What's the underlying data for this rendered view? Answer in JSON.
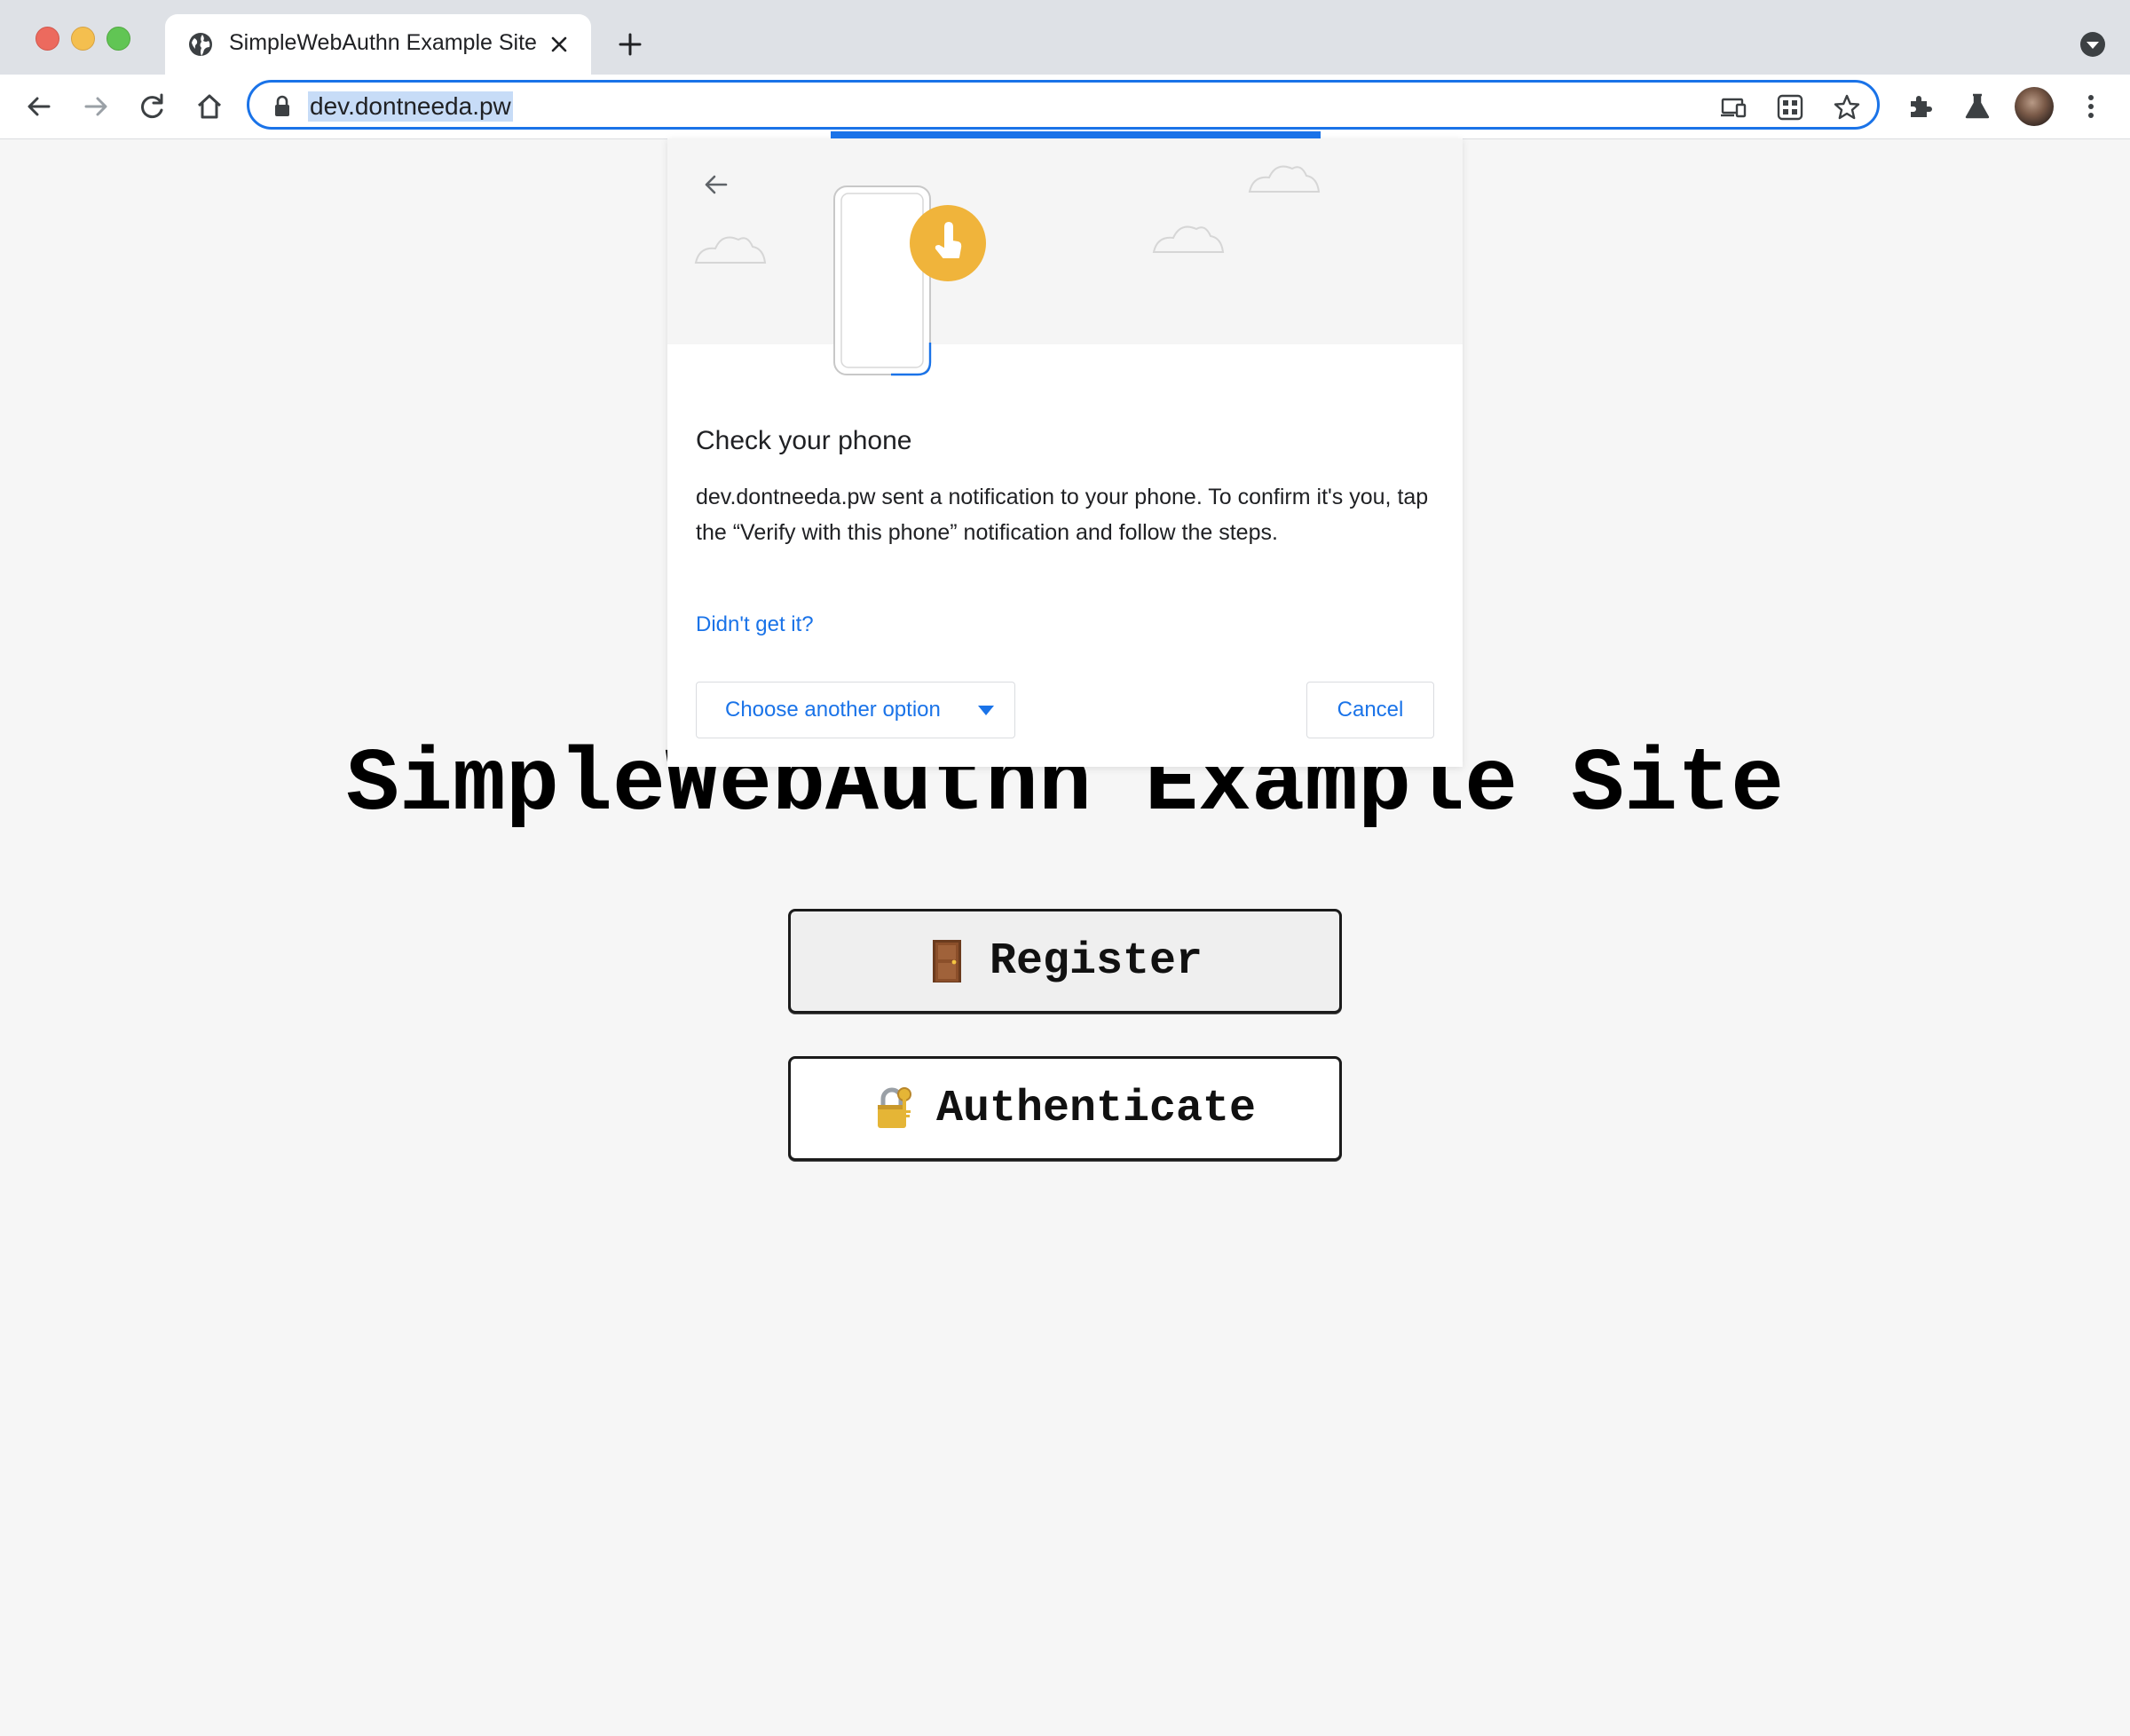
{
  "browser": {
    "tab_title": "SimpleWebAuthn Example Site",
    "url": "dev.dontneeda.pw"
  },
  "dialog": {
    "title": "Check your phone",
    "body": "dev.dontneeda.pw sent a notification to your phone. To confirm it's you, tap the “Verify with this phone” notification and follow the steps.",
    "help_link": "Didn't get it?",
    "choose_option_label": "Choose another option",
    "cancel_label": "Cancel"
  },
  "page": {
    "heading": "SimpleWebAuthn Example Site",
    "register_label": "Register",
    "authenticate_label": "Authenticate"
  },
  "colors": {
    "accent": "#1a73e8",
    "page_background": "#f6f6f6",
    "touch_badge": "#f0b43b"
  },
  "icons": [
    "globe-icon",
    "close-icon",
    "plus-icon",
    "tab-search-icon",
    "back-icon",
    "forward-icon",
    "reload-icon",
    "home-icon",
    "lock-icon",
    "cast-icon",
    "qr-icon",
    "star-icon",
    "extensions-icon",
    "labs-icon",
    "avatar",
    "menu-icon",
    "door-icon",
    "lock-with-key-icon"
  ]
}
